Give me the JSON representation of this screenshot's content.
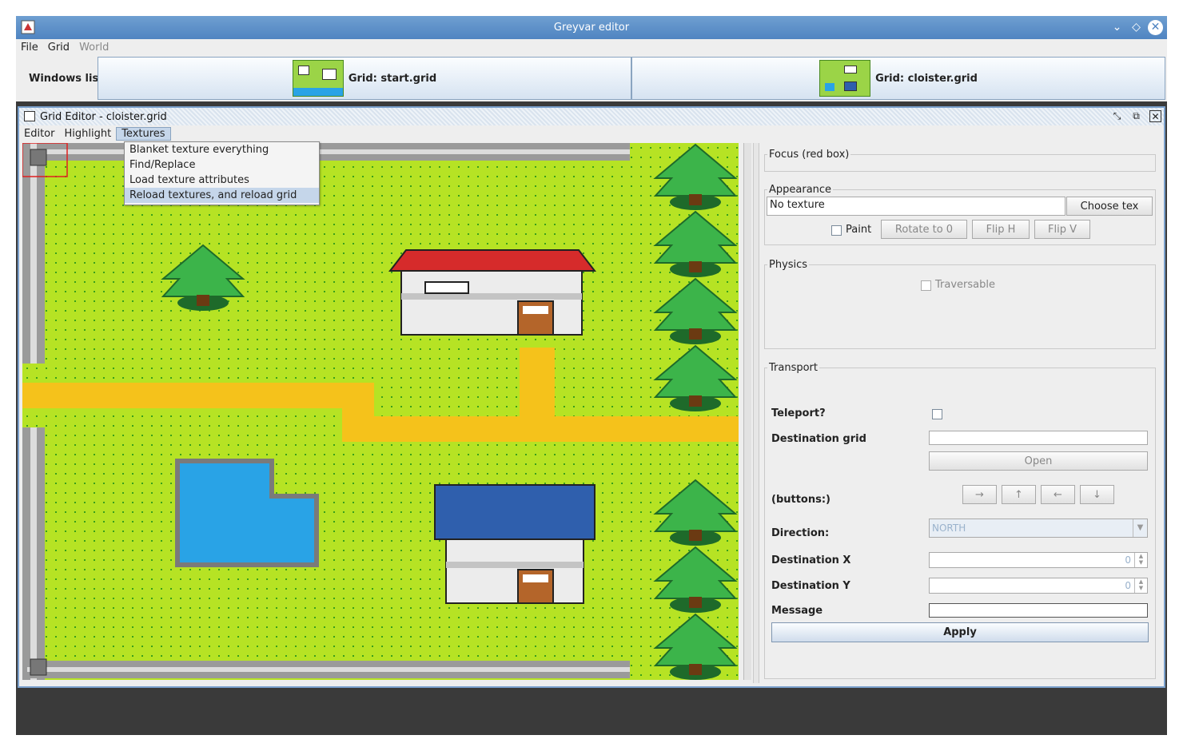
{
  "window": {
    "title": "Greyvar editor"
  },
  "menubar": {
    "items": [
      "File",
      "Grid",
      "World"
    ]
  },
  "windows_list": {
    "label": "Windows list",
    "tabs": [
      {
        "label": "Grid: start.grid"
      },
      {
        "label": "Grid: cloister.grid"
      }
    ]
  },
  "grid_editor": {
    "title": "Grid Editor - cloister.grid",
    "menu": [
      "Editor",
      "Highlight",
      "Textures"
    ],
    "textures_menu": [
      "Blanket texture everything",
      "Find/Replace",
      "Load texture attributes",
      "Reload textures, and reload grid"
    ]
  },
  "panel": {
    "focus": {
      "title": "Focus (red box)"
    },
    "appearance": {
      "title": "Appearance",
      "texture_value": "No texture",
      "choose_button": "Choose tex",
      "paint_label": "Paint",
      "rotate_button": "Rotate to 0",
      "fliph_button": "Flip H",
      "flipv_button": "Flip V"
    },
    "physics": {
      "title": "Physics",
      "traversable_label": "Traversable"
    },
    "transport": {
      "title": "Transport",
      "teleport_label": "Teleport?",
      "dest_grid_label": "Destination grid",
      "dest_grid_value": "",
      "open_button": "Open",
      "buttons_label": "(buttons:)",
      "arrow_buttons": [
        "→",
        "↑",
        "←",
        "↓"
      ],
      "direction_label": "Direction:",
      "direction_value": "NORTH",
      "dest_x_label": "Destination X",
      "dest_x_value": "0",
      "dest_y_label": "Destination Y",
      "dest_y_value": "0",
      "message_label": "Message",
      "message_value": "",
      "apply_button": "Apply"
    }
  },
  "colors": {
    "accent": "#4f84c1",
    "grass": "#b6e324",
    "path": "#f5c21b",
    "water": "#29a3e6",
    "roof_red": "#d62b2b",
    "roof_blue": "#2f5fad"
  }
}
